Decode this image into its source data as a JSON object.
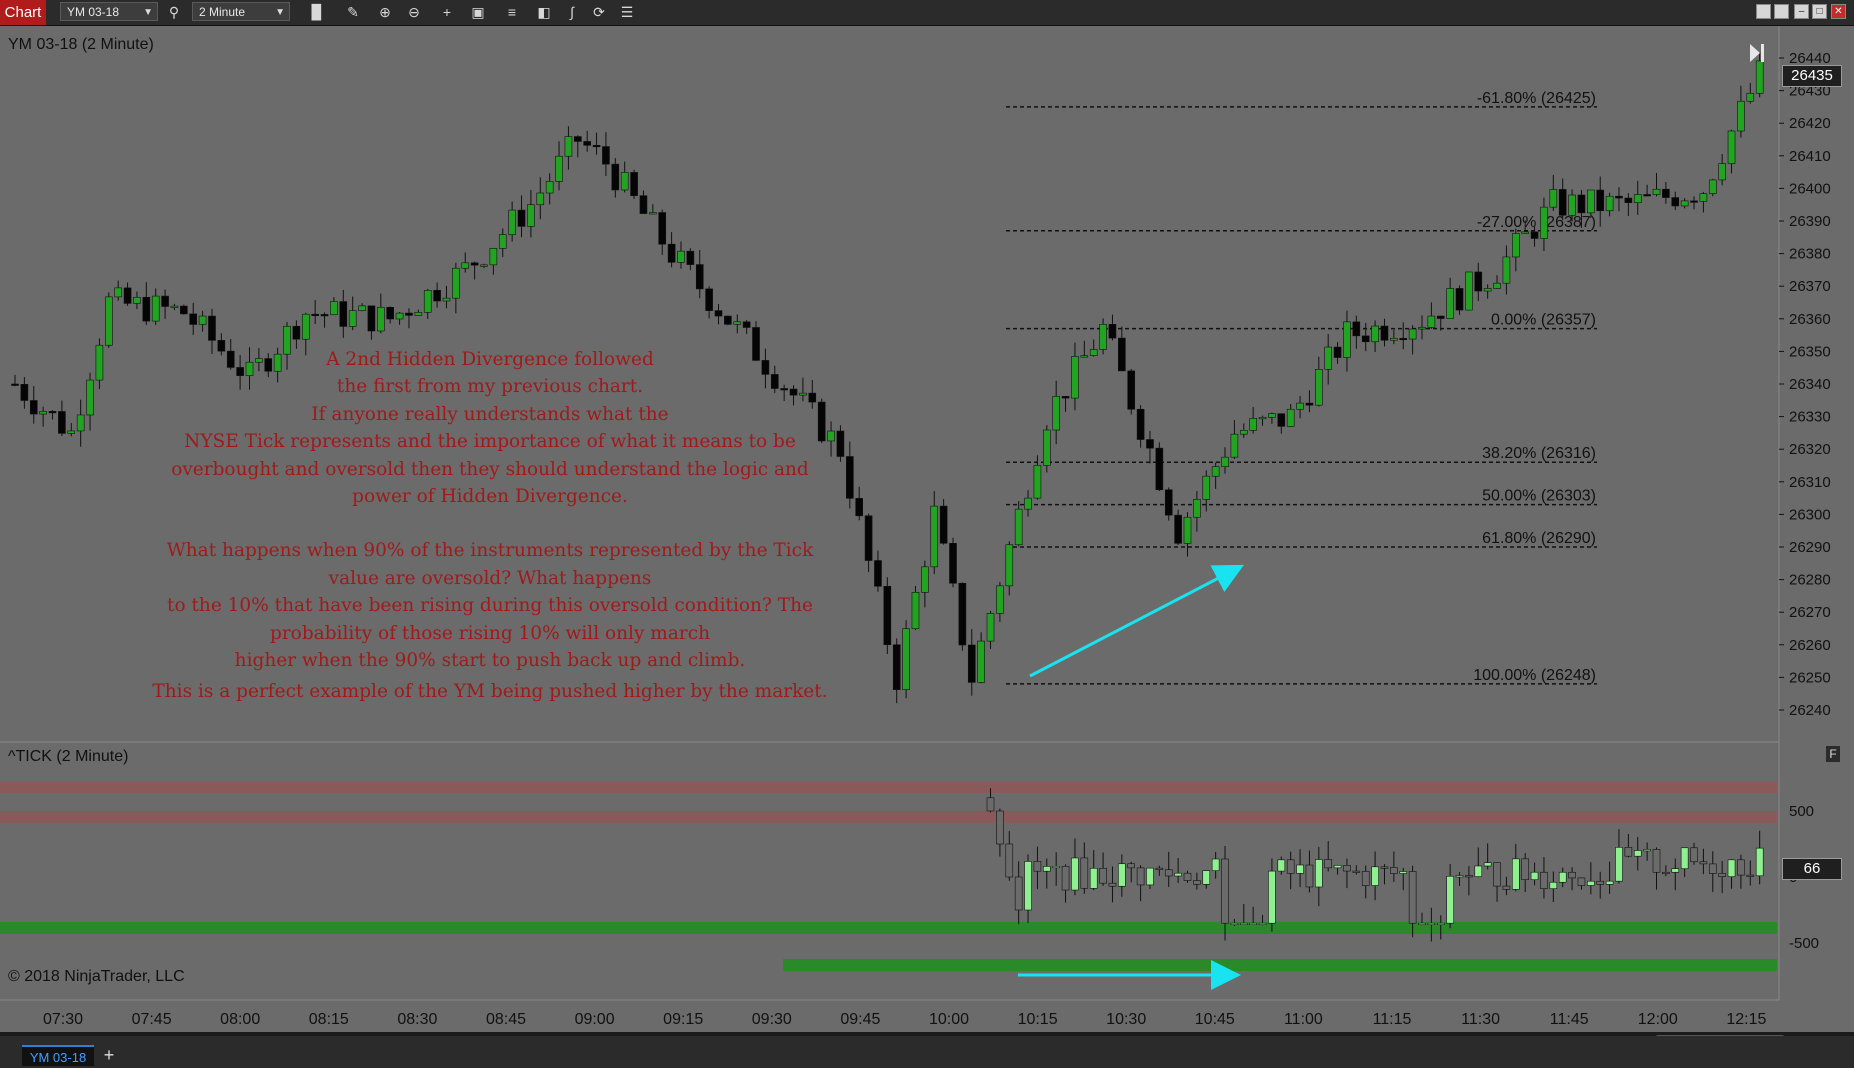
{
  "toolbar": {
    "title": "Chart",
    "instrument": "YM 03-18",
    "interval": "2 Minute",
    "icons": [
      "search-icon",
      "bar-style-icon",
      "pencil-icon",
      "zoom-in-icon",
      "zoom-out-icon",
      "crosshair-icon",
      "data-box-icon",
      "properties-icon",
      "templates-icon",
      "strategies-icon",
      "refresh-icon",
      "list-icon"
    ],
    "window_buttons": [
      "restore-icon",
      "tile-icon",
      "minimize-icon",
      "maximize-icon",
      "close-icon"
    ]
  },
  "price_panel": {
    "label": "YM 03-18 (2 Minute)",
    "current_price": "26435",
    "y_ticks": [
      "26440",
      "26430",
      "26420",
      "26410",
      "26400",
      "26390",
      "26380",
      "26370",
      "26360",
      "26350",
      "26340",
      "26330",
      "26320",
      "26310",
      "26300",
      "26290",
      "26280",
      "26270",
      "26260",
      "26250",
      "26240"
    ],
    "fib_levels": [
      {
        "label": "-61.80% (26425)",
        "price": 26425
      },
      {
        "label": "-27.00% (26387)",
        "price": 26387
      },
      {
        "label": "0.00% (26357)",
        "price": 26357
      },
      {
        "label": "38.20% (26316)",
        "price": 26316
      },
      {
        "label": "50.00% (26303)",
        "price": 26303
      },
      {
        "label": "61.80% (26290)",
        "price": 26290
      },
      {
        "label": "100.00% (26248)",
        "price": 26248
      }
    ]
  },
  "annotation": {
    "lines_1": [
      "A 2nd Hidden Divergence followed",
      "the first from my previous chart.",
      "If anyone really understands what the",
      "NYSE Tick represents and the importance of what it means to be",
      "overbought and oversold then they  should understand the logic and",
      "power of Hidden Divergence."
    ],
    "lines_2": [
      "What happens when 90% of the instruments represented by the Tick",
      "value are oversold?  What happens",
      "to the 10% that have been rising during this oversold condition? The",
      "probability of those rising 10% will only march",
      "higher when the 90% start to push back up and climb."
    ],
    "line_3": "This is a perfect example of the YM being pushed higher by the market."
  },
  "tick_panel": {
    "label": "^TICK (2 Minute)",
    "current_value": "66",
    "y_ticks": [
      "500",
      "0",
      "-500"
    ],
    "button_label": "F"
  },
  "copyright": "© 2018 NinjaTrader, LLC",
  "x_axis": {
    "ticks": [
      "07:30",
      "07:45",
      "08:00",
      "08:15",
      "08:30",
      "08:45",
      "09:00",
      "09:15",
      "09:30",
      "09:45",
      "10:00",
      "10:15",
      "10:30",
      "10:45",
      "11:00",
      "11:15",
      "11:30",
      "11:45",
      "12:00",
      "12:15"
    ]
  },
  "tabs": {
    "active": "YM 03-18",
    "add_label": "+"
  },
  "colors": {
    "chart_bg": "#6b6b6b",
    "up_candle": "#22a322",
    "down_candle": "#050505",
    "tick_up": "#8ff08f",
    "arrow": "#19e3f0",
    "overbought_band": "#8a5a5a",
    "oversold_band": "#2a8a2a",
    "annotation_text": "#a11a1a"
  }
}
